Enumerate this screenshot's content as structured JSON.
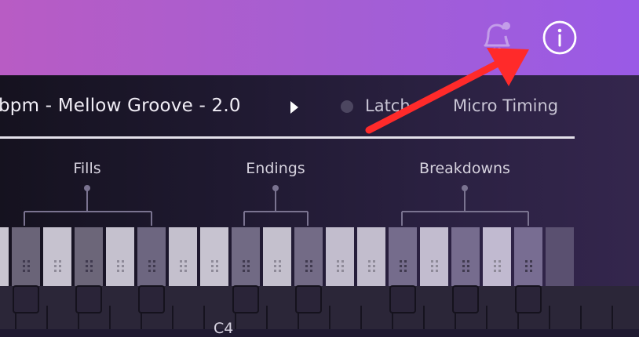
{
  "header": {
    "icons": {
      "bell": "bell-notification-icon",
      "info": "info-icon"
    },
    "colors": {
      "gradient_start": "#b85cc4",
      "gradient_end": "#9a5ae6"
    }
  },
  "toolbar": {
    "preset_name": "bpm - Mellow Groove - 2.0",
    "latch_label": "Latch",
    "micro_timing_label": "Micro Timing"
  },
  "groups": [
    {
      "label": "Fills"
    },
    {
      "label": "Endings"
    },
    {
      "label": "Breakdowns"
    }
  ],
  "keyboard": {
    "octave_label": "C4"
  },
  "annotation": {
    "arrow_color": "#ff2a2a"
  }
}
